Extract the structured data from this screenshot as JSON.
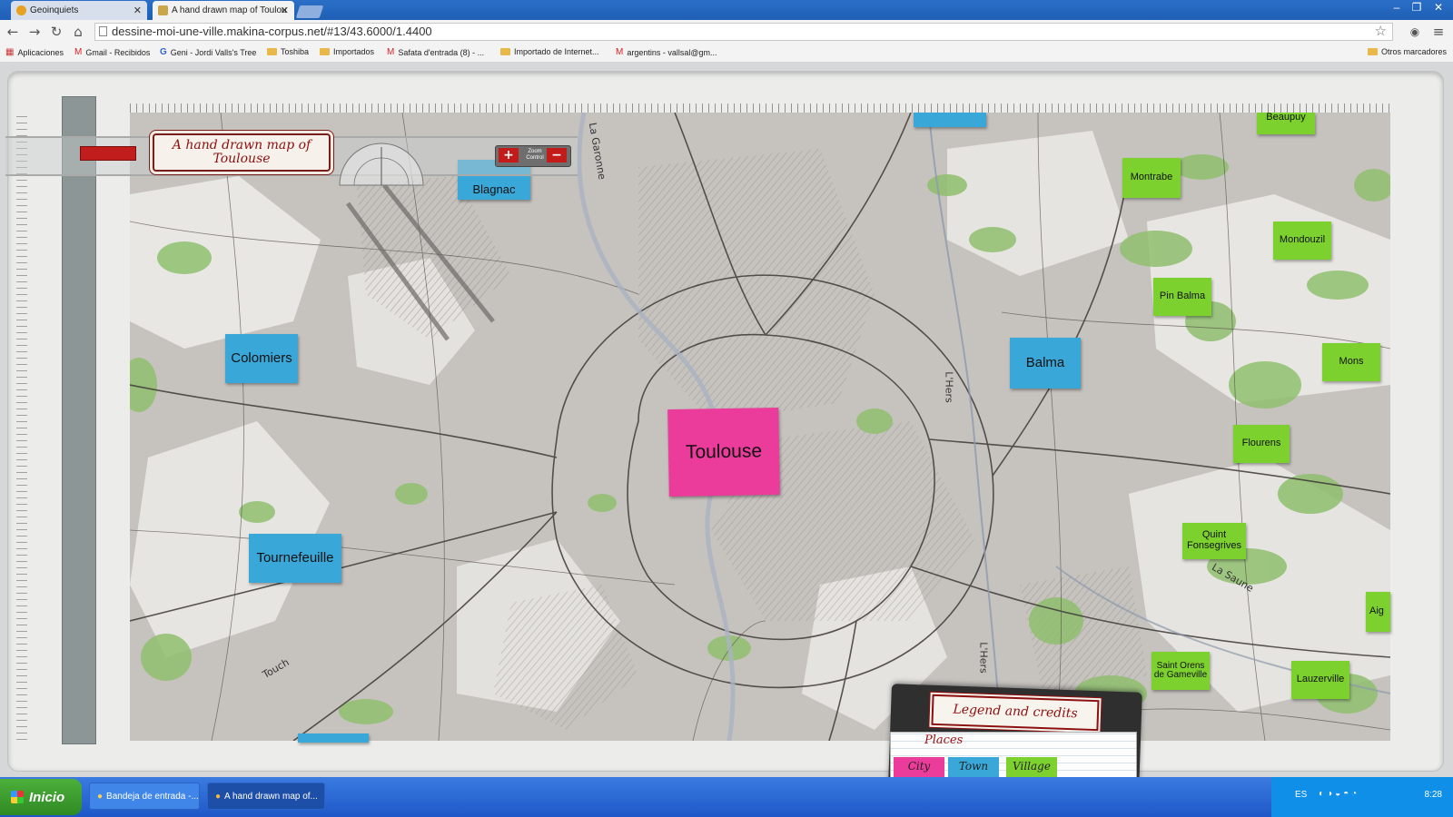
{
  "browser": {
    "tabs": [
      {
        "label": "Geoinquiets",
        "active": false
      },
      {
        "label": "A hand drawn map of Toulou",
        "active": true
      }
    ],
    "url": "dessine-moi-une-ville.makina-corpus.net/#13/43.6000/1.4400",
    "bookmarks": [
      {
        "label": "Aplicaciones",
        "icon": "apps-grid-icon"
      },
      {
        "label": "Gmail - Recibidos",
        "icon": "gmail-icon"
      },
      {
        "label": "Geni - Jordi Valls's Tree",
        "icon": "google-icon"
      },
      {
        "label": "Toshiba",
        "icon": "folder-icon"
      },
      {
        "label": "Importados",
        "icon": "folder-icon"
      },
      {
        "label": "Safata d'entrada (8) - ...",
        "icon": "gmail-icon"
      },
      {
        "label": "Importado de Internet...",
        "icon": "folder-icon"
      },
      {
        "label": "argentins - vallsal@gm...",
        "icon": "gmail-icon"
      },
      {
        "label": "Otros marcadores",
        "icon": "folder-icon"
      }
    ]
  },
  "app": {
    "title": "A hand drawn map of Toulouse",
    "zoom_control_label": "Zoom Control",
    "zoom_in_symbol": "+",
    "zoom_out_symbol": "−",
    "legend": {
      "title": "Legend and credits",
      "section": "Places",
      "items": [
        {
          "label": "City",
          "color": "#ec3c9b"
        },
        {
          "label": "Town",
          "color": "#39a8d9"
        },
        {
          "label": "Village",
          "color": "#7dd12e"
        }
      ]
    }
  },
  "map": {
    "places": [
      {
        "name": "Toulouse",
        "type": "city"
      },
      {
        "name": "Blagnac",
        "type": "town"
      },
      {
        "name": "Colomiers",
        "type": "town"
      },
      {
        "name": "Balma",
        "type": "town"
      },
      {
        "name": "Tournefeuille",
        "type": "town"
      },
      {
        "name": "Beaupuy",
        "type": "village"
      },
      {
        "name": "Montrabe",
        "type": "village"
      },
      {
        "name": "Mondouzil",
        "type": "village"
      },
      {
        "name": "Pin Balma",
        "type": "village"
      },
      {
        "name": "Mons",
        "type": "village"
      },
      {
        "name": "Flourens",
        "type": "village"
      },
      {
        "name": "Quint Fonsegrives",
        "type": "village"
      },
      {
        "name": "Saint Orens de Gameville",
        "type": "village"
      },
      {
        "name": "Lauzerville",
        "type": "village"
      },
      {
        "name": "Aig",
        "type": "village"
      }
    ],
    "waterways": [
      {
        "name": "La Garonne"
      },
      {
        "name": "L'Hers"
      },
      {
        "name": "L'Hers"
      },
      {
        "name": "La Saune"
      },
      {
        "name": "Touch"
      }
    ]
  },
  "taskbar": {
    "start_label": "Inicio",
    "tasks": [
      {
        "label": "Bandeja de entrada -...",
        "active": false
      },
      {
        "label": "A hand drawn map of...",
        "active": true
      }
    ],
    "lang": "ES",
    "clock": "8:28"
  },
  "colors": {
    "city": "#ec3c9b",
    "town": "#39a8d9",
    "village": "#7dd12e",
    "accent_red": "#c21d1d"
  }
}
